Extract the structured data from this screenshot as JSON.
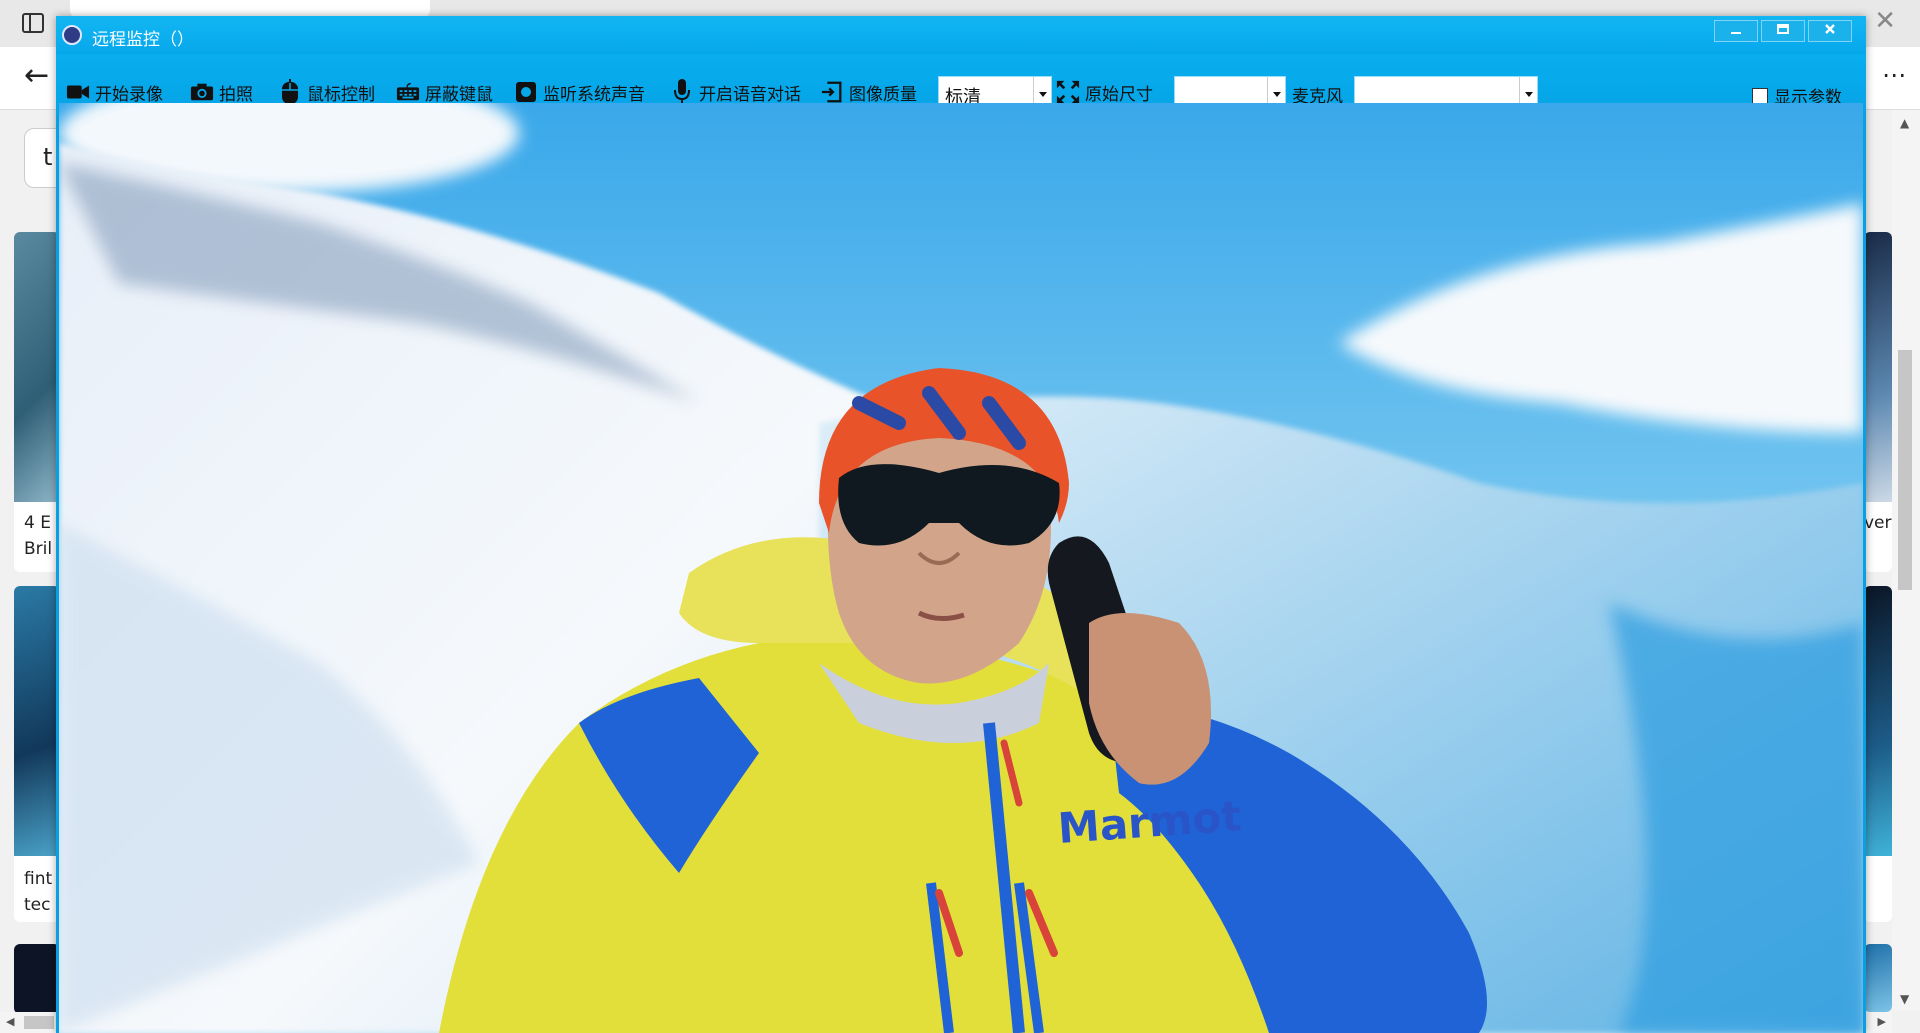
{
  "background": {
    "search_text": "t",
    "cards": [
      {
        "line1": "4 E",
        "line2": "Bril"
      },
      {
        "line1": "fint",
        "line2": "tec"
      },
      {
        "line1": "ver",
        "line2": ""
      }
    ]
  },
  "window": {
    "title": "远程监控（）",
    "controls": [
      "minimize",
      "maximize",
      "close"
    ]
  },
  "toolbar": {
    "record": "开始录像",
    "snapshot": "拍照",
    "mouse_control": "鼠标控制",
    "block_keyboard_mouse": "屏蔽键鼠",
    "listen_system_audio": "监听系统声音",
    "voice_chat": "开启语音对话",
    "image_quality_label": "图像质量",
    "image_quality_value": "标清",
    "original_size": "原始尺寸",
    "original_size_value": "",
    "microphone_label": "麦克风",
    "microphone_value": "",
    "show_params": "显示参数",
    "show_params_checked": false
  },
  "video": {
    "jacket_brand": "Marmot"
  },
  "colors": {
    "window_blue": "#06a8ec",
    "hat_orange": "#e8532a",
    "jacket_yellow": "#e3df3a",
    "jacket_blue": "#1f63d6"
  }
}
